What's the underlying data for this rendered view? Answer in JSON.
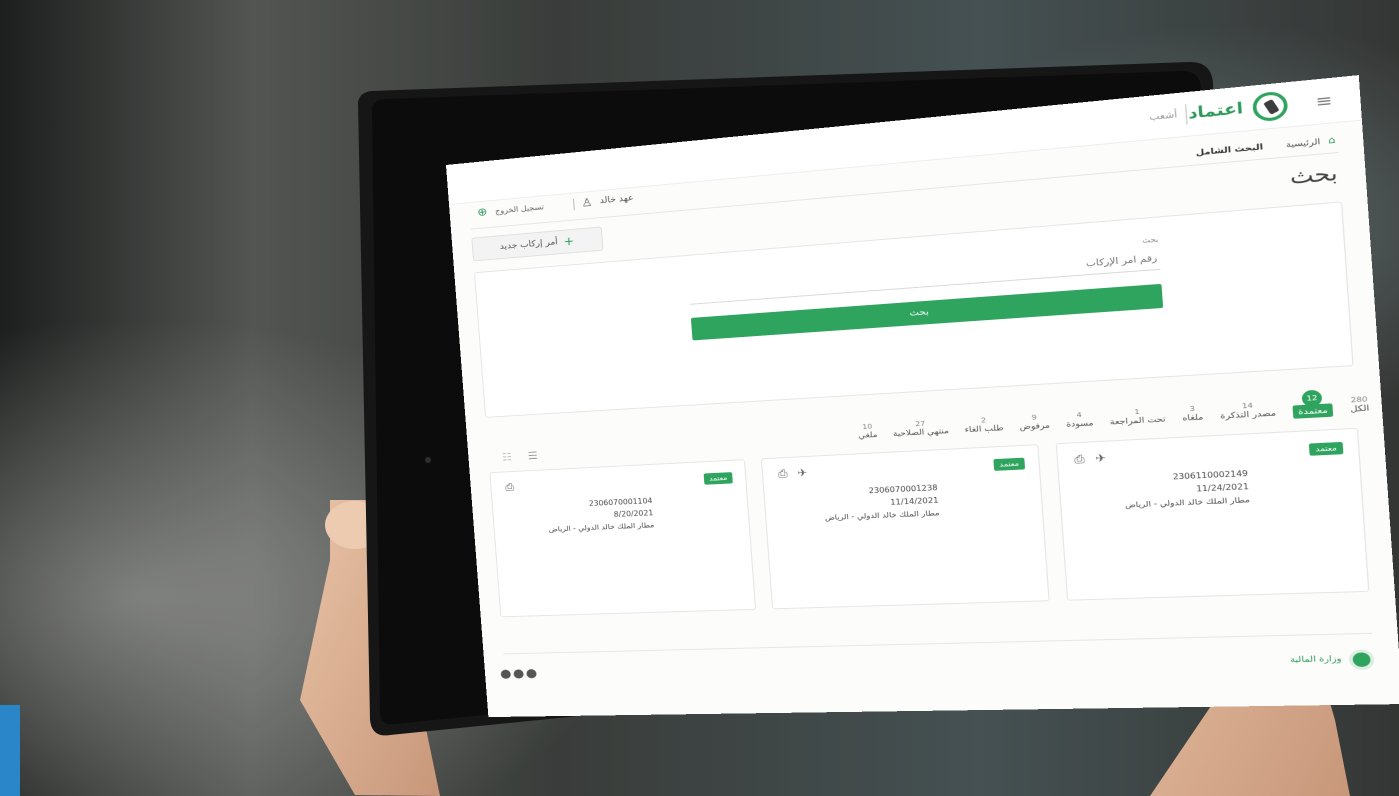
{
  "app": {
    "brand_ar": "اعتماد",
    "sub_brand": "أشعب",
    "user_name": "عهد خالد",
    "logout_label": "تسجيل الخروج",
    "breadcrumb": [
      "الرئيسية",
      "البحث الشامل"
    ]
  },
  "page": {
    "title": "بحث",
    "new_order_button": "أمر إركاب جديد",
    "search_section_label": "بحث",
    "search_placeholder": "رقم أمر الإركاب",
    "search_button": "بحث"
  },
  "filters": [
    {
      "label": "الكل",
      "count": "280"
    },
    {
      "label": "معتمدة",
      "count": "12"
    },
    {
      "label": "مصدر التذكرة",
      "count": "14"
    },
    {
      "label": "ملغاه",
      "count": "3"
    },
    {
      "label": "تحت المراجعة",
      "count": "1"
    },
    {
      "label": "مسودة",
      "count": "4"
    },
    {
      "label": "مرفوض",
      "count": "9"
    },
    {
      "label": "طلب الغاء",
      "count": "2"
    },
    {
      "label": "منتهي الصلاحية",
      "count": "27"
    },
    {
      "label": "ملغي",
      "count": "10"
    }
  ],
  "cards": [
    {
      "status": "معتمد",
      "labels": [
        "",
        "",
        "",
        "",
        "",
        ""
      ],
      "values": [
        "2306110002149",
        "11/24/2021",
        "مطار الملك خالد الدولي - الرياض",
        "",
        "",
        ""
      ]
    },
    {
      "status": "معتمد",
      "labels": [
        "",
        "",
        "",
        "",
        "",
        ""
      ],
      "values": [
        "2306070001238",
        "11/14/2021",
        "مطار الملك خالد الدولي - الرياض",
        "",
        "",
        ""
      ]
    },
    {
      "status": "معتمد",
      "labels": [
        "",
        "",
        "",
        "",
        "",
        ""
      ],
      "values": [
        "2306070001104",
        "8/20/2021",
        "مطار الملك خالد الدولي - الرياض",
        "",
        "",
        ""
      ]
    }
  ],
  "footer": {
    "copyright": "",
    "links": "",
    "email": "",
    "partner_label": "وزارة المالية"
  },
  "colors": {
    "accent": "#2fa45f",
    "accent_text": "#2d9a5a"
  }
}
